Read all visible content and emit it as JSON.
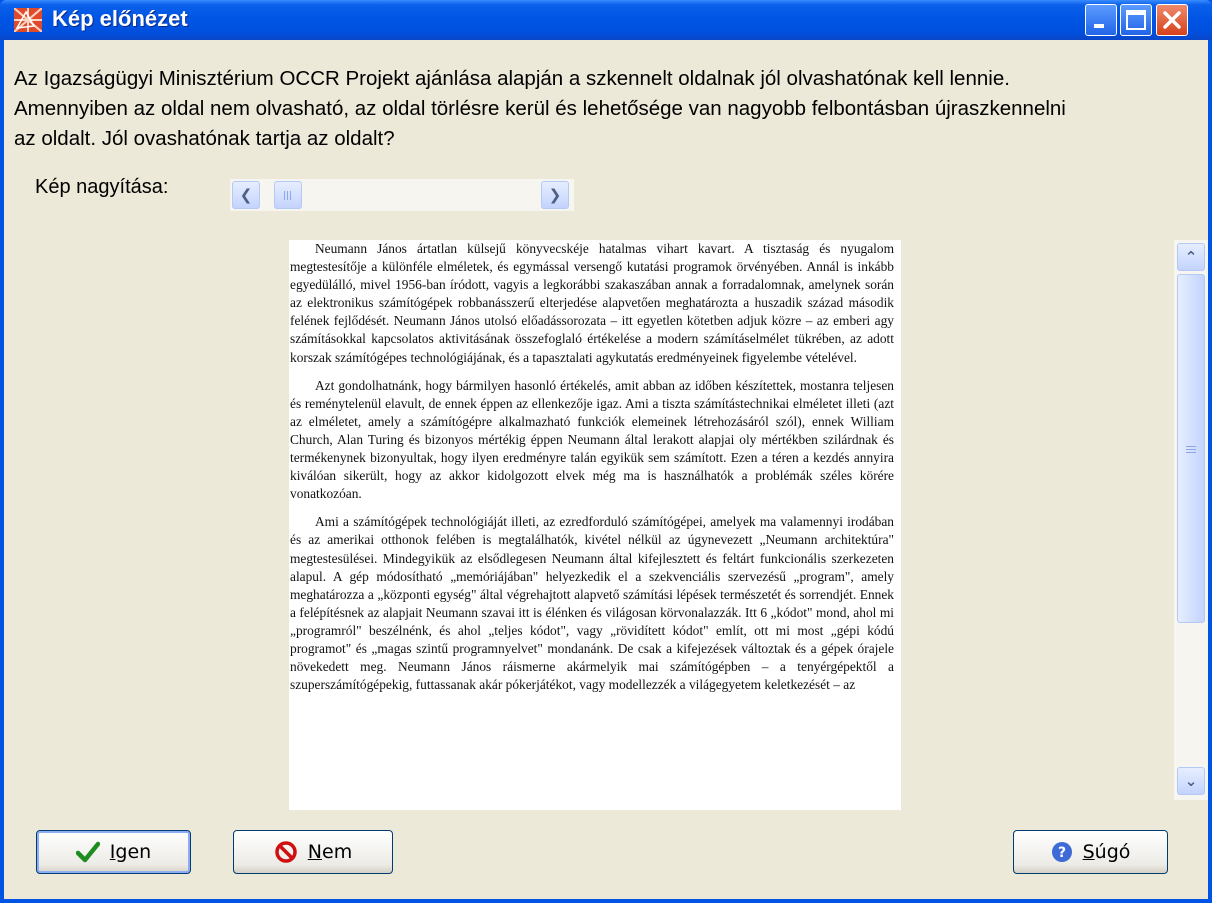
{
  "window": {
    "title": "Kép előnézet",
    "controls": {
      "minimize": "minimize",
      "maximize": "maximize",
      "close": "close"
    }
  },
  "message": {
    "lines": [
      "Az Igazságügyi Minisztérium OCCR Projekt ajánlása alapján a szkennelt oldalnak jól olvashatónak kell lennie.",
      "Amennyiben az oldal nem olvasható, az oldal törlésre kerül és lehetősége van nagyobb felbontásban újraszkennelni",
      "az oldalt. Jól ovashatónak tartja az oldalt?"
    ]
  },
  "zoom": {
    "label": "Kép nagyítása:",
    "slider_position": 0.05
  },
  "preview": {
    "paragraphs": [
      "Neumann János ártatlan külsejű könyvecskéje hatalmas vihart kavart. A tisztaság és nyugalom megtestesítője a különféle elméletek, és egymással versengő kutatási programok örvényében. Annál is inkább egyedülálló, mivel 1956-ban íródott, vagyis a legkorábbi szakaszában annak a forradalomnak, amelynek során az elektronikus számítógépek robbanásszerű elterjedése alapvetően meghatározta a huszadik század második felének fejlődését. Neumann János utolsó előadássorozata – itt egyetlen kötetben adjuk közre – az emberi agy számításokkal kapcsolatos aktivitásának összefoglaló értékelése a modern számításelmélet tükrében, az adott korszak számítógépes technológiájának, és a tapasztalati agykutatás eredményeinek figyelembe vételével.",
      "Azt gondolhatnánk, hogy bármilyen hasonló értékelés, amit abban az időben készítettek, mostanra teljesen és reménytelenül elavult, de ennek éppen az ellenkezője igaz. Ami a tiszta számítástechnikai elméletet illeti (azt az elméletet, amely a számítógépre alkalmazható funkciók elemeinek létrehozásáról szól), ennek William Church, Alan Turing és bizonyos mértékig éppen Neumann által lerakott alapjai oly mértékben szilárdnak és termékenynek bizonyultak, hogy ilyen eredményre talán egyikük sem számított. Ezen a téren a kezdés annyira kiválóan sikerült, hogy az akkor kidolgozott elvek még ma is használhatók a problémák széles körére vonatkozóan.",
      "Ami a számítógépek technológiáját illeti, az ezredforduló számítógépei, amelyek ma valamennyi irodában és az amerikai otthonok felében is megtalálhatók, kivétel nélkül az úgynevezett „Neumann architektúra\" megtestesülései. Mindegyikük az elsődlegesen Neumann által kifejlesztett és feltárt funkcionális szerkezeten alapul. A gép módosítható „memóriájában\" helyezkedik el a szekvenciális szervezésű „program\", amely meghatározza a „központi egység\" által végrehajtott alapvető számítási lépések természetét és sorrendjét. Ennek a felépítésnek az alapjait Neumann szavai itt is élénken és világosan körvonalazzák. Itt 6 „kódot\" mond, ahol mi „programról\" beszélnénk, és ahol „teljes kódot\", vagy „rövidített kódot\" említ, ott mi most „gépi kódú programot\" és „magas szintű programnyelvet\" mondanánk. De csak a kifejezések változtak és a gépek órajele növekedett meg. Neumann János ráismerne akármelyik mai számítógépben – a tenyérgépektől a szuperszámítógépekig, futtassanak akár pókerjátékot, vagy modellezzék a világegyetem keletkezését – az"
    ]
  },
  "buttons": {
    "yes": {
      "label": "Igen",
      "underline": "I",
      "rest": "gen"
    },
    "no": {
      "label": "Nem",
      "underline": "N",
      "rest": "em"
    },
    "help": {
      "label": "Súgó",
      "underline": "S",
      "rest": "úgó"
    }
  },
  "colors": {
    "title_bar": "#0055e5",
    "client_bg": "#ece9d8",
    "close_button": "#d5411b",
    "yes_check": "#1e8c1e",
    "no_icon": "#d01010",
    "help_icon": "#3d6ad6"
  }
}
